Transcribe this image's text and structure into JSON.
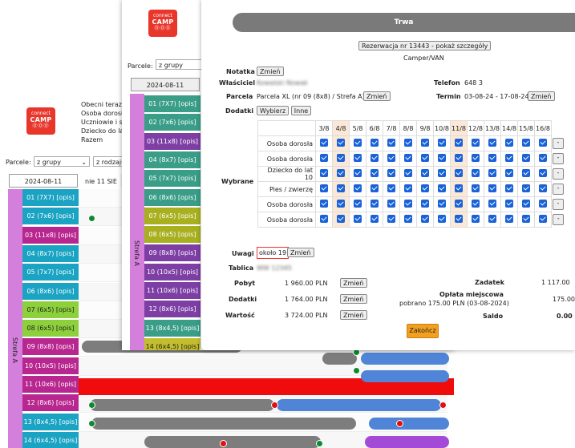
{
  "logo": {
    "line1": "connect",
    "line2": "CAMP",
    "dots": "⓪⓪⓪"
  },
  "front": {
    "obecni_lines": [
      "Obecni teraz:",
      "Osoba dorosła",
      "Uczniowie i stu",
      "Dziecko do lat",
      "Razem"
    ],
    "parcele_label": "Parcele:",
    "group_select": "z grupy",
    "kind_select": "z rodzaju",
    "date": "2024-08-11",
    "day_label": "nie 11 SIE",
    "zone": "Strefa A",
    "rows": [
      "01 (7X7) [opis]",
      "02 (7x6) [opis]",
      "03 (11x8) [opis]",
      "04 (8x7) [opis]",
      "05 (7x7) [opis]",
      "06 (8x6) [opis]",
      "07 (6x5) [opis]",
      "08 (6x5) [opis]",
      "09 (8x8) [opis]",
      "10 (10x5) [opis]",
      "11 (10x6) [opis]",
      "12 (8x6) [opis]",
      "13 (8x4,5) [opis]",
      "14 (6x4,5) [opis]"
    ]
  },
  "mid": {
    "parcele_label": "Parcele:",
    "group_select": "z grupy",
    "date": "2024-08-11",
    "zone": "Strefa A",
    "rows": [
      "01 (7X7) [opis]",
      "02 (7x6) [opis]",
      "03 (11x8) [opis]",
      "04 (8x7) [opis]",
      "05 (7x7) [opis]",
      "06 (8x6) [opis]",
      "07 (6x5) [opis]",
      "08 (6x5) [opis]",
      "09 (8x8) [opis]",
      "10 (10x5) [opis]",
      "11 (10x6) [opis]",
      "12 (8x6) [opis]",
      "13 (8x4,5) [opis]",
      "14 (6x4,5) [opis]"
    ]
  },
  "dialog": {
    "status": "Trwa",
    "reservation_button": "Rezerwacja nr 13443 - pokaż szczegóły",
    "type": "Camper/VAN",
    "notatka_label": "Notatka",
    "zmien": "Zmień",
    "wlasciciel_label": "Właściciel",
    "wlasciciel_value": "Kowalski Nowak",
    "telefon_label": "Telefon",
    "telefon_value": "648 3",
    "parcela_label": "Parcela",
    "parcela_value": "Parcela XL (nr 09 (8x8) / Strefa A)",
    "termin_label": "Termin",
    "termin_value": "03-08-24 - 17-08-24",
    "dodatki_label": "Dodatki",
    "wybierz": "Wybierz",
    "inne": "Inne",
    "wybrane_label": "Wybrane",
    "days": [
      "3/8",
      "4/8",
      "5/8",
      "6/8",
      "7/8",
      "8/8",
      "9/8",
      "10/8",
      "11/8",
      "12/8",
      "13/8",
      "14/8",
      "15/8",
      "16/8"
    ],
    "persons": [
      "Osoba dorosła",
      "Osoba dorosła",
      "Dziecko do lat 10",
      "Pies / zwierzę",
      "Osoba dorosła",
      "Osoba dorosła"
    ],
    "minus": "-",
    "uwagi_label": "Uwagi",
    "uwagi_value": "około 19",
    "tablica_label": "Tablica",
    "tablica_value": "WW 12345",
    "pobyt_label": "Pobyt",
    "pobyt_value": "1 960.00 PLN",
    "dodatki2_label": "Dodatki",
    "dodatki2_value": "1 764.00 PLN",
    "wartosc_label": "Wartość",
    "wartosc_value": "3 724.00 PLN",
    "zadatek_label": "Zadatek",
    "zadatek_value": "1 117.00",
    "oplata_label": "Opłata miejscowa",
    "oplata_sub": "pobrano 175.00 PLN (03-08-2024)",
    "oplata_value": "175.00",
    "saldo_label": "Saldo",
    "saldo_value": "0.00",
    "zakoncz": "Zakończ"
  }
}
